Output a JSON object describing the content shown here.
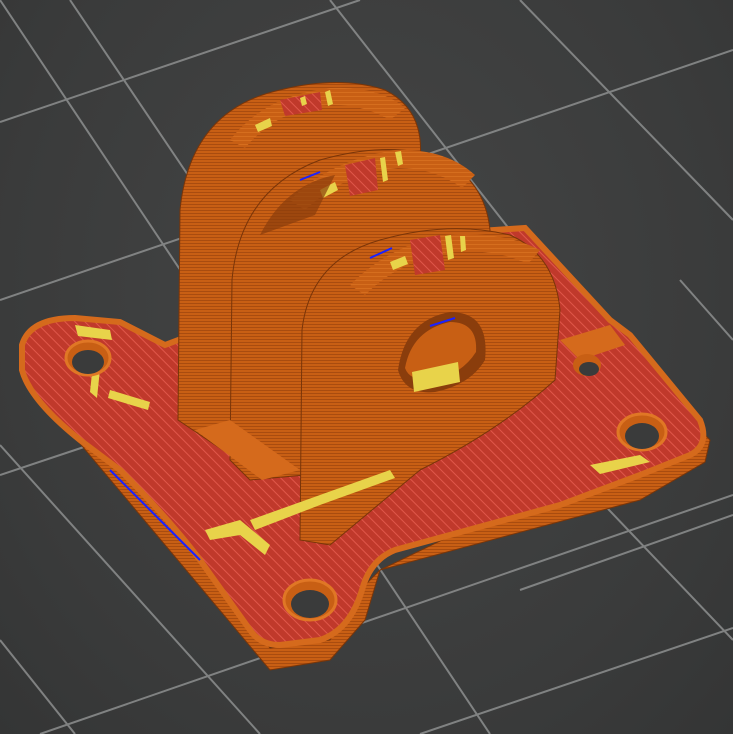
{
  "viewport": {
    "background_color": "#3e3f3f",
    "grid_color": "#8d8f8f"
  },
  "part": {
    "perimeter_color": "#c85f14",
    "perimeter_shadow_color": "#8a3d0c",
    "infill_color": "#c0392b",
    "infill_line_color": "#e0574a",
    "top_solid_color": "#e8d34a",
    "travel_color": "#1a22ff",
    "mounting_hole_icon": "circle-hole"
  }
}
